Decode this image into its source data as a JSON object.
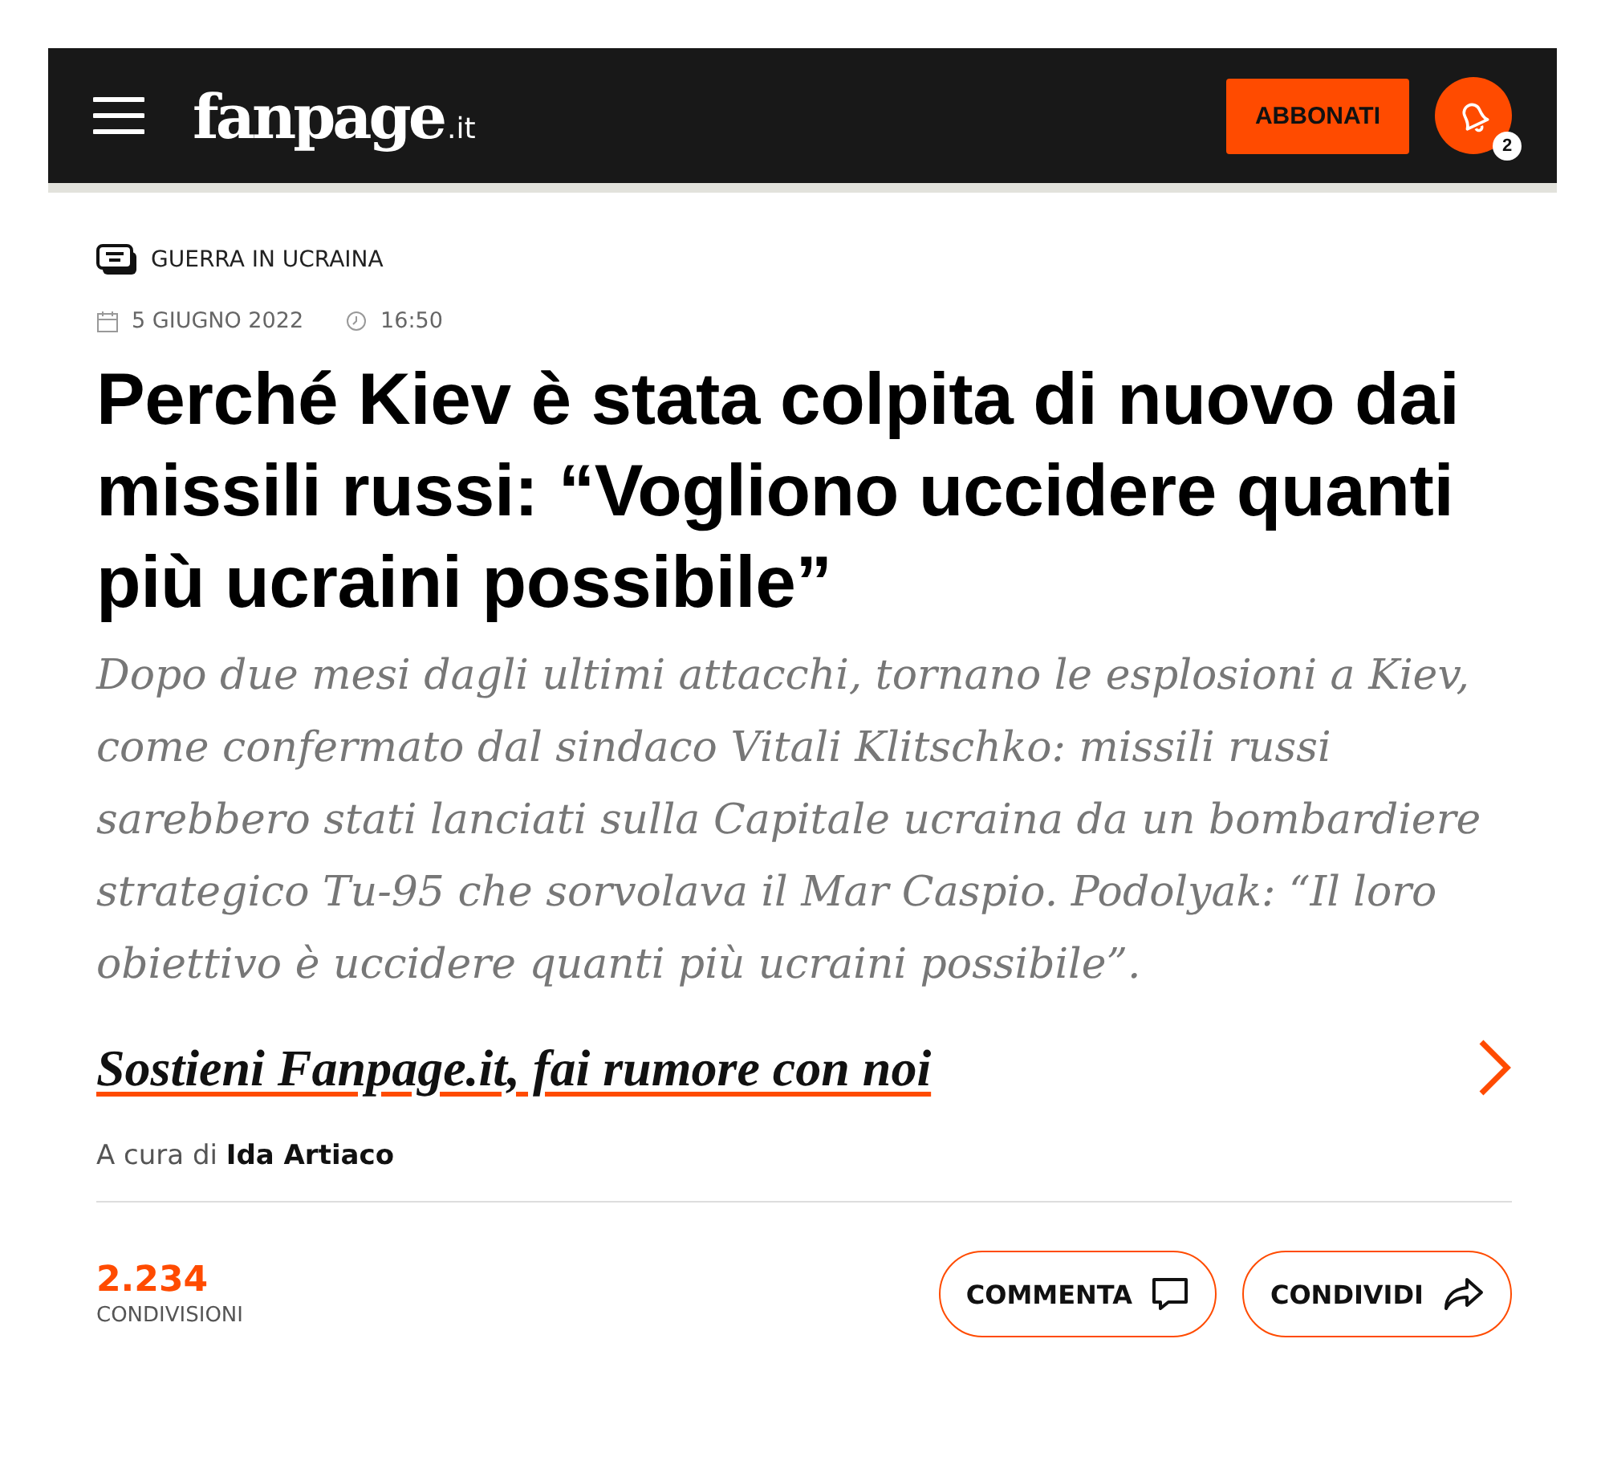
{
  "header": {
    "logo": "fanpage",
    "logo_suffix": ".it",
    "subscribe_button": "ABBONATI",
    "notifications_badge": "2"
  },
  "category": "GUERRA IN UCRAINA",
  "date": "5 GIUGNO 2022",
  "time": "16:50",
  "title": "Perché Kiev è stata colpita di nuovo dai missili russi: “Vogliono uccidere quanti più ucraini possibile”",
  "lead": "Dopo due mesi dagli ultimi attacchi, tornano le esplosioni a Kiev, come confermato dal sindaco Vitali Klitschko: missili russi sarebbero stati lanciati sulla Capitale ucraina da un bombardiere strategico Tu-95 che sorvolava il Mar Caspio. Podolyak: “Il loro obiettivo è uccidere quanti più ucraini possibile”.",
  "support_link": "Sostieni Fanpage.it, fai rumore con noi",
  "byline": "A cura di **Ida Artiaco**",
  "shares": {
    "count": "2.234",
    "label": "CONDIVISIONI"
  },
  "buttons": [
    {
      "label": "COMMENTA",
      "kind": "comment"
    },
    {
      "label": "CONDIVIDI",
      "kind": "share"
    }
  ]
}
